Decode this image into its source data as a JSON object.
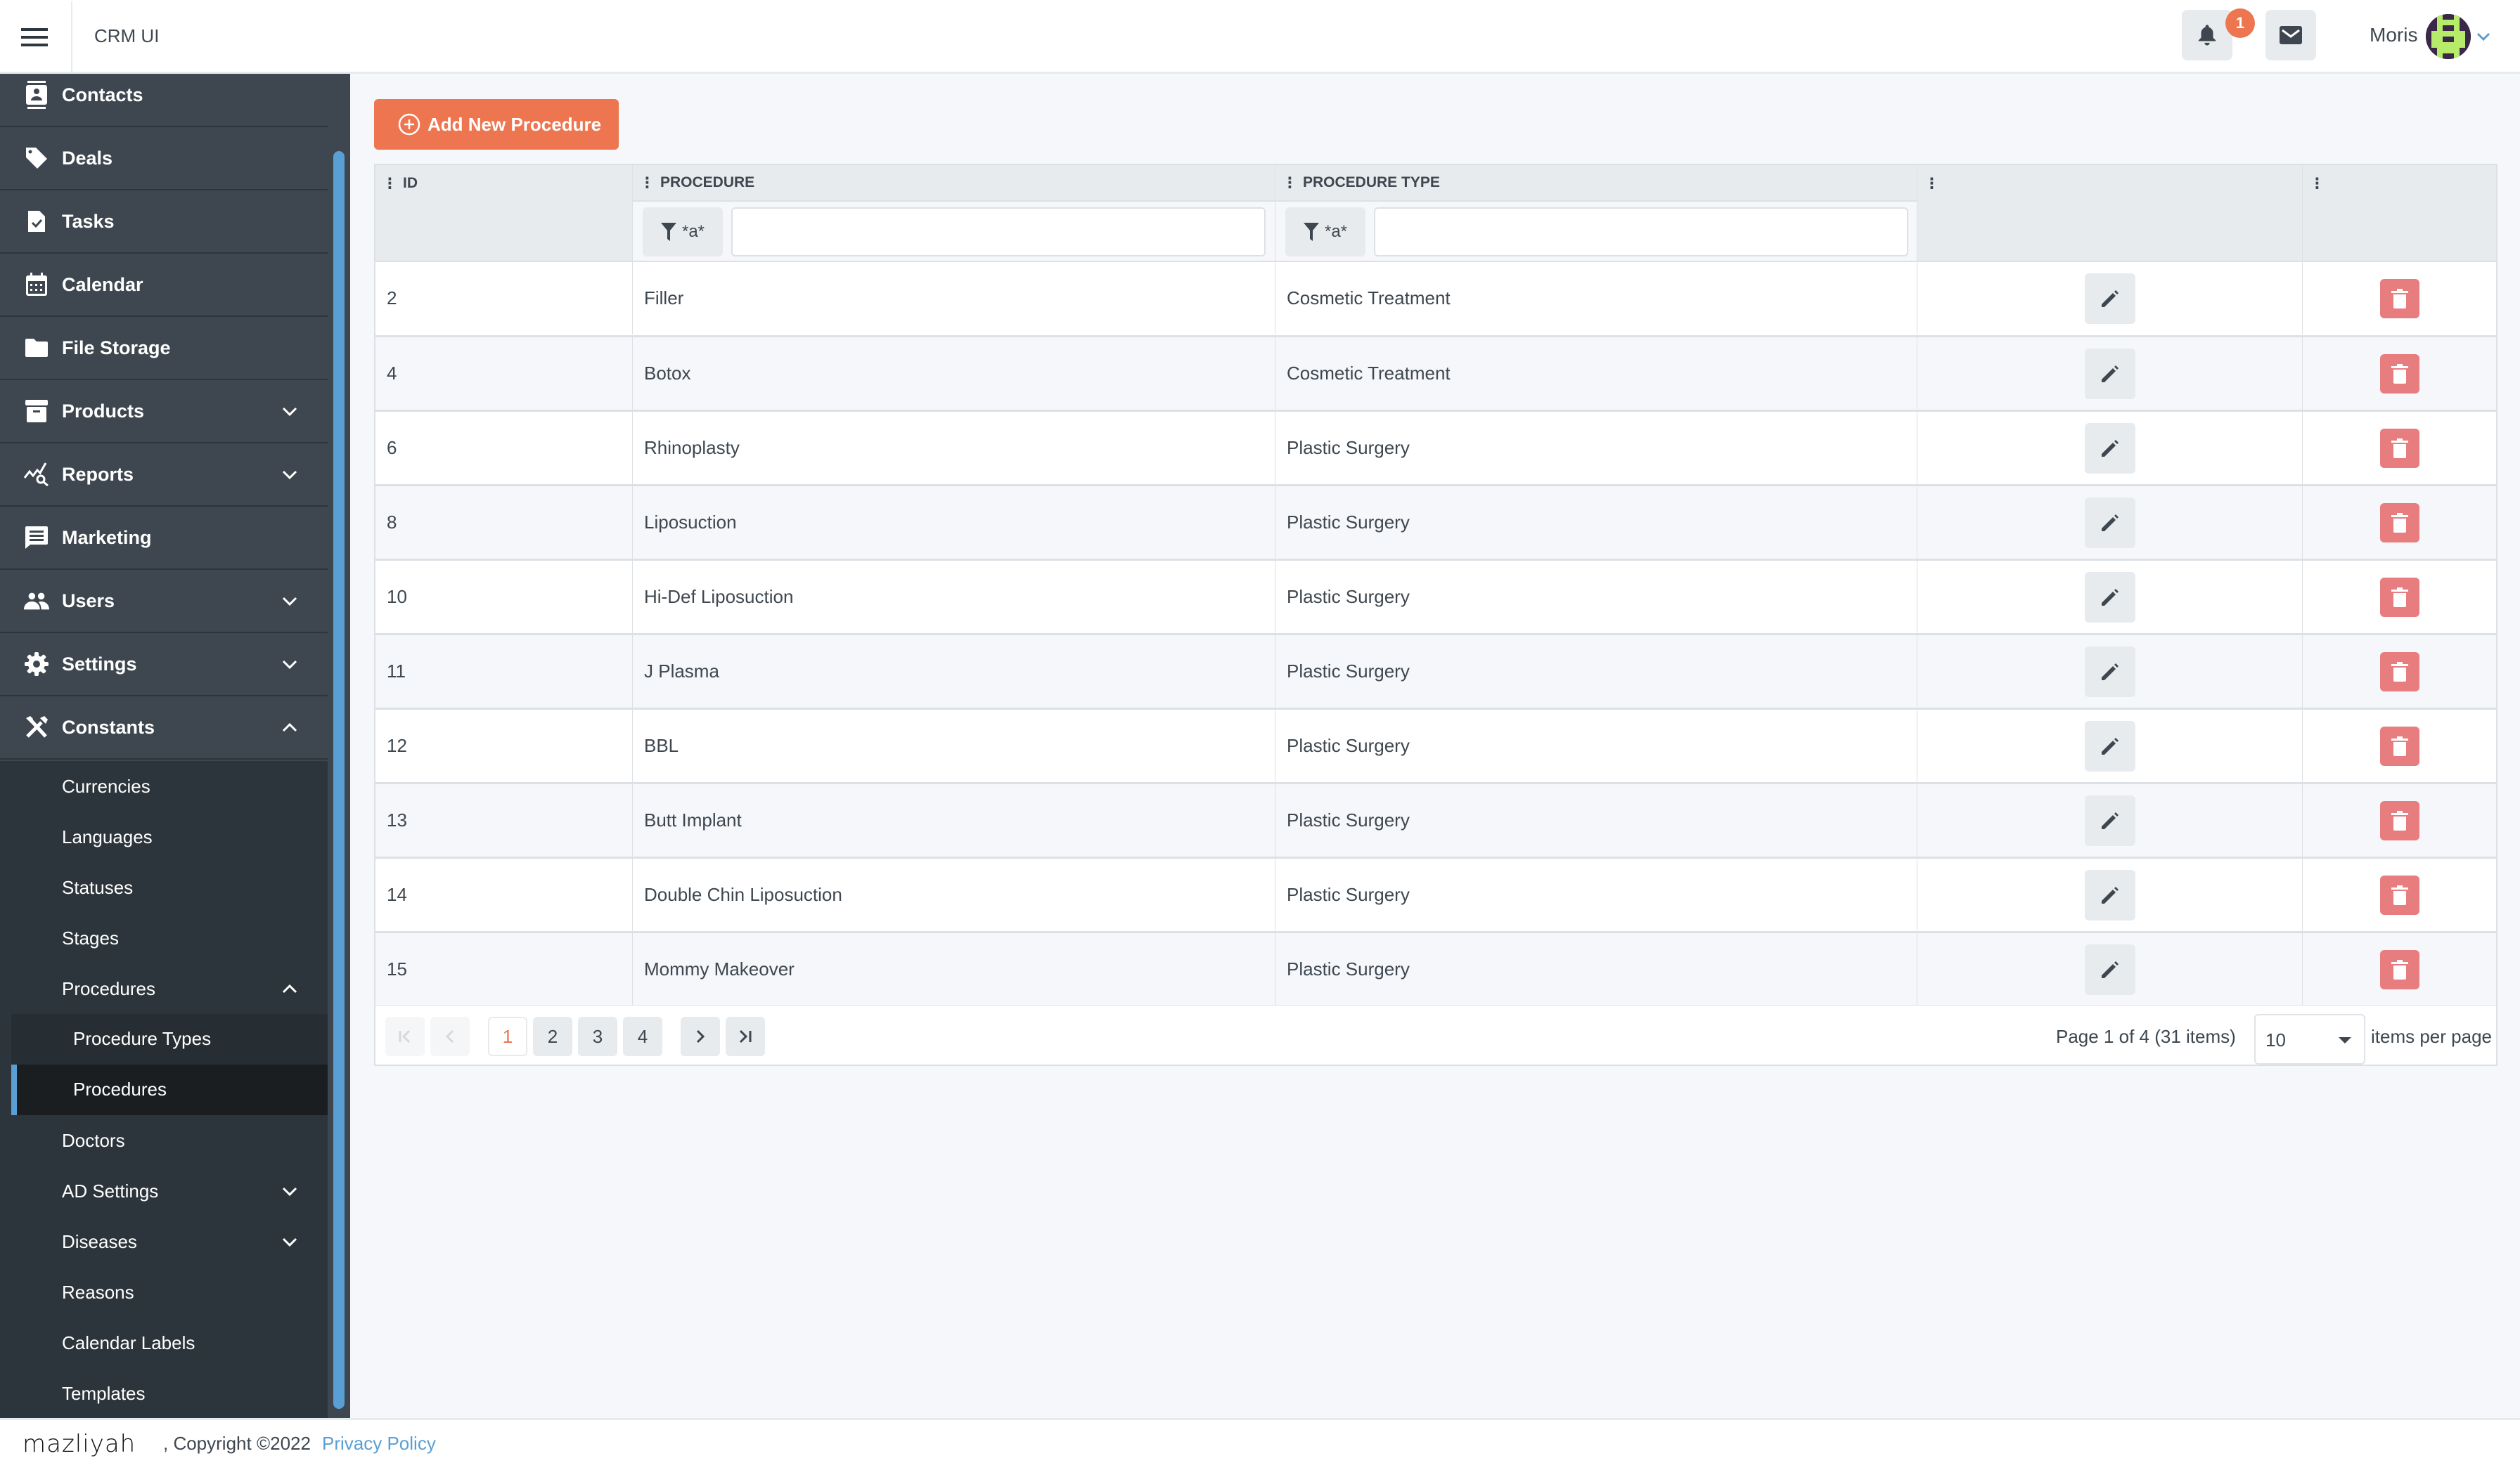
{
  "header": {
    "app_title": "CRM UI",
    "notification_count": "1",
    "user_name": "Moris",
    "icons": {
      "menu": "hamburger-icon",
      "notifications": "bell-icon",
      "messages": "envelope-icon",
      "user_menu": "chevron-down-icon"
    }
  },
  "sidebar": {
    "items": [
      {
        "label": "Contacts",
        "icon": "address-book-icon",
        "has_children": false
      },
      {
        "label": "Deals",
        "icon": "tag-icon",
        "has_children": false
      },
      {
        "label": "Tasks",
        "icon": "file-check-icon",
        "has_children": false
      },
      {
        "label": "Calendar",
        "icon": "calendar-icon",
        "has_children": false
      },
      {
        "label": "File Storage",
        "icon": "folder-icon",
        "has_children": false
      },
      {
        "label": "Products",
        "icon": "archive-icon",
        "has_children": true,
        "expanded": false
      },
      {
        "label": "Reports",
        "icon": "chart-search-icon",
        "has_children": true,
        "expanded": false
      },
      {
        "label": "Marketing",
        "icon": "message-icon",
        "has_children": false
      },
      {
        "label": "Users",
        "icon": "users-icon",
        "has_children": true,
        "expanded": false
      },
      {
        "label": "Settings",
        "icon": "gear-icon",
        "has_children": true,
        "expanded": false
      },
      {
        "label": "Constants",
        "icon": "tools-icon",
        "has_children": true,
        "expanded": true
      }
    ],
    "constants_children": [
      {
        "label": "Currencies"
      },
      {
        "label": "Languages"
      },
      {
        "label": "Statuses"
      },
      {
        "label": "Stages"
      },
      {
        "label": "Procedures",
        "has_children": true,
        "expanded": true
      },
      {
        "label": "Doctors"
      },
      {
        "label": "AD Settings",
        "has_children": true,
        "expanded": false
      },
      {
        "label": "Diseases",
        "has_children": true,
        "expanded": false
      },
      {
        "label": "Reasons"
      },
      {
        "label": "Calendar Labels"
      },
      {
        "label": "Templates"
      }
    ],
    "procedures_children": [
      {
        "label": "Procedure Types",
        "active": false
      },
      {
        "label": "Procedures",
        "active": true
      }
    ]
  },
  "main": {
    "add_button_label": "Add New Procedure",
    "columns": [
      {
        "key": "id",
        "label": "ID"
      },
      {
        "key": "procedure",
        "label": "PROCEDURE"
      },
      {
        "key": "procedure_type",
        "label": "PROCEDURE TYPE"
      },
      {
        "key": "edit",
        "label": ""
      },
      {
        "key": "delete",
        "label": ""
      }
    ],
    "filters": {
      "procedure": {
        "operator": "*a*",
        "value": ""
      },
      "procedure_type": {
        "operator": "*a*",
        "value": ""
      }
    },
    "rows": [
      {
        "id": "2",
        "procedure": "Filler",
        "procedure_type": "Cosmetic Treatment"
      },
      {
        "id": "4",
        "procedure": "Botox",
        "procedure_type": "Cosmetic Treatment"
      },
      {
        "id": "6",
        "procedure": "Rhinoplasty",
        "procedure_type": "Plastic Surgery"
      },
      {
        "id": "8",
        "procedure": "Liposuction",
        "procedure_type": "Plastic Surgery"
      },
      {
        "id": "10",
        "procedure": "Hi-Def Liposuction",
        "procedure_type": "Plastic Surgery"
      },
      {
        "id": "11",
        "procedure": "J Plasma",
        "procedure_type": "Plastic Surgery"
      },
      {
        "id": "12",
        "procedure": "BBL",
        "procedure_type": "Plastic Surgery"
      },
      {
        "id": "13",
        "procedure": "Butt Implant",
        "procedure_type": "Plastic Surgery"
      },
      {
        "id": "14",
        "procedure": "Double Chin Liposuction",
        "procedure_type": "Plastic Surgery"
      },
      {
        "id": "15",
        "procedure": "Mommy Makeover",
        "procedure_type": "Plastic Surgery"
      }
    ],
    "pagination": {
      "pages": [
        "1",
        "2",
        "3",
        "4"
      ],
      "current_page": "1",
      "info": "Page 1 of 4 (31 items)",
      "page_size": "10",
      "per_page_label": "items per page"
    }
  },
  "footer": {
    "brand": "mazliyah",
    "copyright": ", Copyright ©2022",
    "privacy_link": "Privacy Policy"
  },
  "colors": {
    "accent": "#ed7650",
    "sidebar_bg": "#3e474f",
    "sidebar_sub_bg": "#2c353b",
    "active_indicator": "#5a9fd4",
    "delete": "#e87d7f",
    "link": "#5a9fd4"
  }
}
